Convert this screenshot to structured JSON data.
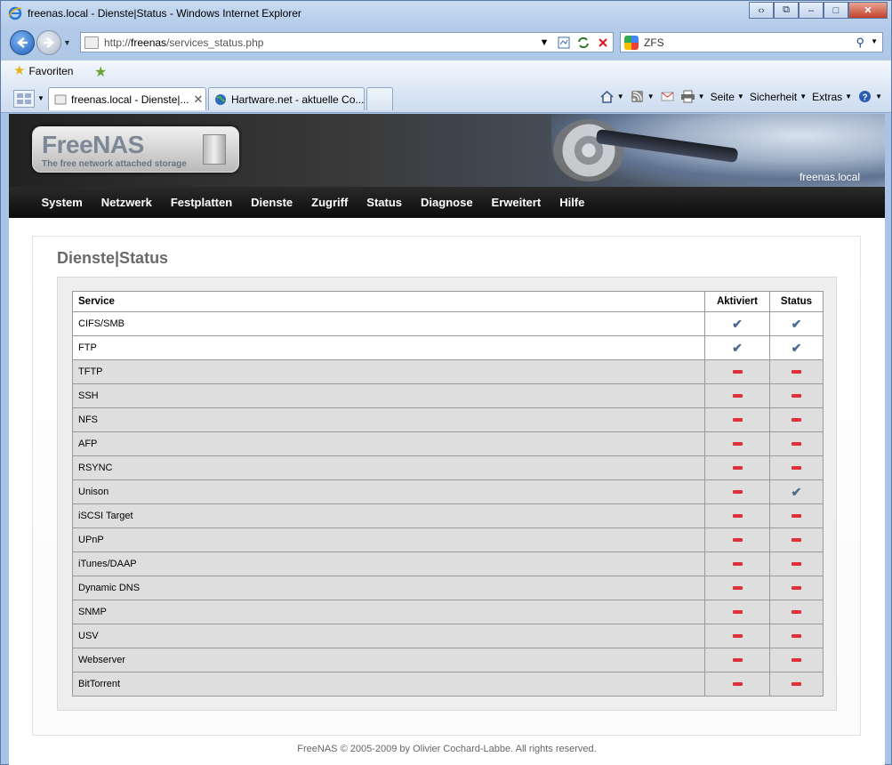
{
  "window": {
    "title": "freenas.local - Dienste|Status - Windows Internet Explorer",
    "controls": [
      "‹›",
      "⧉",
      "–",
      "□",
      "✕"
    ]
  },
  "address_bar": {
    "url_prefix": "http://",
    "url_host": "freenas",
    "url_path": "/services_status.php"
  },
  "search_bar": {
    "value": "ZFS"
  },
  "favorites_bar": {
    "label": "Favoriten"
  },
  "tabs": [
    {
      "label": "freenas.local - Dienste|...",
      "active": true
    },
    {
      "label": "Hartware.net - aktuelle Co...",
      "active": false
    }
  ],
  "command_bar": {
    "page": "Seite",
    "security": "Sicherheit",
    "extras": "Extras"
  },
  "site": {
    "logo_name": "FreeNAS",
    "logo_tagline": "The free network attached storage",
    "hostname": "freenas.local",
    "nav": [
      "System",
      "Netzwerk",
      "Festplatten",
      "Dienste",
      "Zugriff",
      "Status",
      "Diagnose",
      "Erweitert",
      "Hilfe"
    ],
    "page_title": "Dienste|Status",
    "table": {
      "headers": [
        "Service",
        "Aktiviert",
        "Status"
      ],
      "rows": [
        {
          "service": "CIFS/SMB",
          "enabled": true,
          "running": true
        },
        {
          "service": "FTP",
          "enabled": true,
          "running": true
        },
        {
          "service": "TFTP",
          "enabled": false,
          "running": false
        },
        {
          "service": "SSH",
          "enabled": false,
          "running": false
        },
        {
          "service": "NFS",
          "enabled": false,
          "running": false
        },
        {
          "service": "AFP",
          "enabled": false,
          "running": false
        },
        {
          "service": "RSYNC",
          "enabled": false,
          "running": false
        },
        {
          "service": "Unison",
          "enabled": false,
          "running": true
        },
        {
          "service": "iSCSI Target",
          "enabled": false,
          "running": false
        },
        {
          "service": "UPnP",
          "enabled": false,
          "running": false
        },
        {
          "service": "iTunes/DAAP",
          "enabled": false,
          "running": false
        },
        {
          "service": "Dynamic DNS",
          "enabled": false,
          "running": false
        },
        {
          "service": "SNMP",
          "enabled": false,
          "running": false
        },
        {
          "service": "USV",
          "enabled": false,
          "running": false
        },
        {
          "service": "Webserver",
          "enabled": false,
          "running": false
        },
        {
          "service": "BitTorrent",
          "enabled": false,
          "running": false
        }
      ]
    },
    "footer": "FreeNAS © 2005-2009 by Olivier Cochard-Labbe. All rights reserved."
  },
  "colors": {
    "nav_bg": "#111111",
    "enabled_row": "#ffffff",
    "disabled_row": "#dedede",
    "check": "#4d6c91",
    "minus": "#e0303a"
  }
}
